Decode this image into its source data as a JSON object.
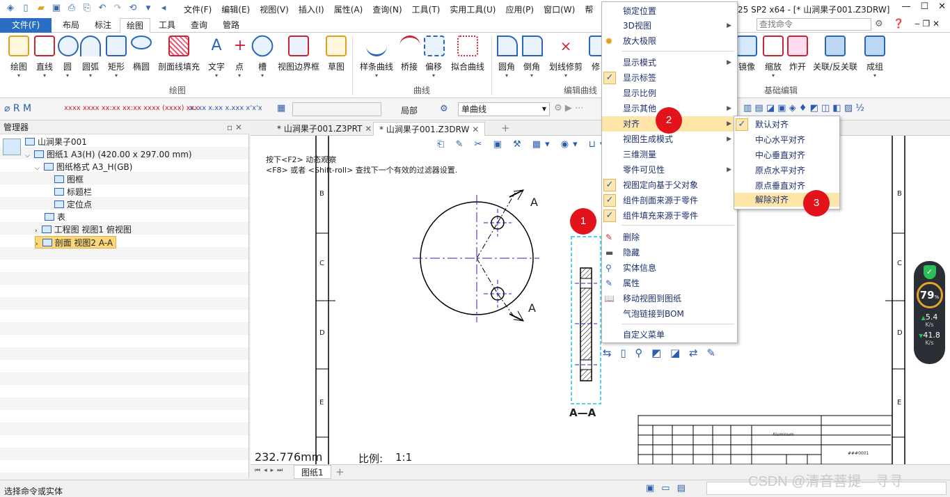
{
  "menu_bar": [
    "文件(F)",
    "编辑(E)",
    "视图(V)",
    "插入(I)",
    "属性(A)",
    "查询(N)",
    "工具(T)",
    "实用工具(U)",
    "应用(P)",
    "窗口(W)",
    "帮"
  ],
  "title_fragment": "25 SP2 x64 - [* 山涧果子001.Z3DRW]",
  "ribbon_tabs": [
    "文件(F)",
    "布局",
    "标注",
    "绘图",
    "工具",
    "查询",
    "管路"
  ],
  "search_placeholder": "查找命令",
  "ribbon": {
    "draw_group": [
      "绘图",
      "直线",
      "圆",
      "圆弧",
      "矩形",
      "椭圆",
      "剖面线填充",
      "文字",
      "点",
      "槽",
      "视图边界框",
      "草图"
    ],
    "draw_group_name": "绘图",
    "curve_group": [
      "样条曲线",
      "桥接",
      "偏移",
      "拟合曲线"
    ],
    "curve_group_name": "曲线",
    "edit_group": [
      "圆角",
      "倒角",
      "划线修剪",
      "修"
    ],
    "edit_group_name": "编辑曲线",
    "basic_group": [
      "镜像",
      "缩放",
      "炸开",
      "关联/反关联",
      "成组"
    ],
    "basic_group_name": "基础编辑"
  },
  "toolbar2": {
    "scope_label": "局部",
    "curve_combo": "单曲线"
  },
  "manager": {
    "title": "管理器",
    "tree": [
      {
        "label": "山涧果子001"
      },
      {
        "label": "图纸1 A3(H) (420.00 x 297.00 mm)"
      },
      {
        "label": "图纸格式 A3_H(GB)"
      },
      {
        "label": "图框"
      },
      {
        "label": "标题栏"
      },
      {
        "label": "定位点"
      },
      {
        "label": "表"
      },
      {
        "label": "工程图 视图1 俯视图"
      },
      {
        "label": "剖面 视图2 A-A"
      }
    ]
  },
  "doc_tabs": [
    "* 山涧果子001.Z3PRT",
    "* 山涧果子001.Z3DRW"
  ],
  "canvas": {
    "hint_line1": "按下<F2> 动态观察",
    "hint_line2": "<F8> 或者 <Shift-roll> 查找下一个有效的过滤器设置.",
    "section_label_top": "A",
    "section_label_bottom": "A",
    "section_view_label": "A—A",
    "dimension": "232.776mm",
    "scale_label": "比例:",
    "scale_value": "1:1",
    "row_letters": [
      "B",
      "C",
      "D",
      "E"
    ],
    "title_block_text": "Aluminum",
    "title_block_code": "###0001"
  },
  "context_menu": {
    "items": [
      {
        "label": "锁定位置",
        "checked": false,
        "submenu": false
      },
      {
        "label": "3D视图",
        "checked": false,
        "submenu": true
      },
      {
        "label": "放大极限",
        "checked": false,
        "submenu": false
      },
      {
        "label": "显示模式",
        "checked": false,
        "submenu": true
      },
      {
        "label": "显示标签",
        "checked": true,
        "submenu": false
      },
      {
        "label": "显示比例",
        "checked": false,
        "submenu": false
      },
      {
        "label": "显示其他",
        "checked": false,
        "submenu": true
      },
      {
        "label": "对齐",
        "checked": false,
        "submenu": true
      },
      {
        "label": "视图生成模式",
        "checked": false,
        "submenu": true
      },
      {
        "label": "三维测量",
        "checked": false,
        "submenu": false
      },
      {
        "label": "零件可见性",
        "checked": false,
        "submenu": true
      },
      {
        "label": "视图定向基于父对象",
        "checked": true,
        "submenu": false
      },
      {
        "label": "组件剖面来源于零件",
        "checked": true,
        "submenu": false
      },
      {
        "label": "组件填充来源于零件",
        "checked": true,
        "submenu": false
      },
      {
        "label": "删除",
        "checked": false,
        "submenu": false
      },
      {
        "label": "隐藏",
        "checked": false,
        "submenu": false
      },
      {
        "label": "实体信息",
        "checked": false,
        "submenu": false
      },
      {
        "label": "属性",
        "checked": false,
        "submenu": false
      },
      {
        "label": "移动视图到图纸",
        "checked": false,
        "submenu": false
      },
      {
        "label": "气泡链接到BOM",
        "checked": false,
        "submenu": false
      },
      {
        "label": "自定义菜单",
        "checked": false,
        "submenu": false
      }
    ]
  },
  "align_submenu": {
    "items": [
      {
        "label": "默认对齐",
        "checked": true
      },
      {
        "label": "中心水平对齐",
        "checked": false
      },
      {
        "label": "中心垂直对齐",
        "checked": false
      },
      {
        "label": "原点水平对齐",
        "checked": false
      },
      {
        "label": "原点垂直对齐",
        "checked": false
      },
      {
        "label": "解除对齐",
        "checked": false
      }
    ]
  },
  "badges": [
    "1",
    "2",
    "3"
  ],
  "perf_widget": {
    "percent": "79",
    "percent_unit": "%",
    "up": "5.4",
    "up_unit": "K/s",
    "down": "41.8",
    "down_unit": "K/s"
  },
  "sheet_tab": "图纸1",
  "status_text": "选择命令或实体",
  "watermark": "CSDN @清音菩提—寻寻",
  "colors": {
    "accent": "#2a6ec3",
    "badge": "#e3131b",
    "highlight": "#fde6a8"
  }
}
